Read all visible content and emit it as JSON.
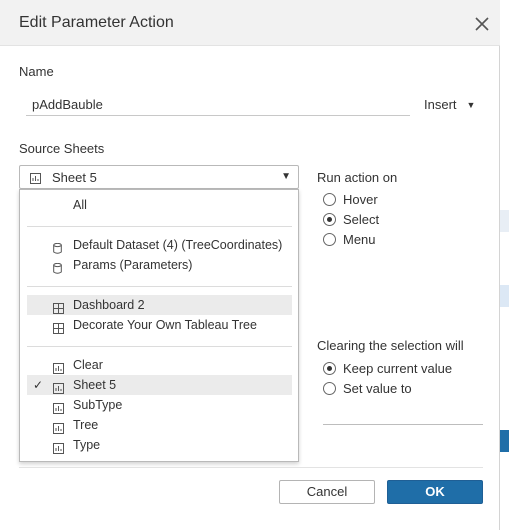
{
  "dialog": {
    "title": "Edit Parameter Action",
    "close_icon": "close-icon"
  },
  "name_section": {
    "label": "Name",
    "value": "pAddBauble",
    "insert_label": "Insert"
  },
  "source": {
    "label": "Source Sheets",
    "selected": "Sheet 5",
    "dropdown": {
      "all_label": "All",
      "datasources": [
        {
          "label": "Default Dataset (4) (TreeCoordinates)",
          "icon": "datasource-icon"
        },
        {
          "label": "Params (Parameters)",
          "icon": "datasource-icon"
        }
      ],
      "dashboards": [
        {
          "label": "Dashboard 2",
          "icon": "dashboard-icon"
        },
        {
          "label": "Decorate Your Own Tableau Tree",
          "icon": "dashboard-icon"
        }
      ],
      "sheets": [
        {
          "label": "Clear",
          "icon": "sheet-icon"
        },
        {
          "label": "Sheet 5",
          "icon": "sheet-icon",
          "checked": true
        },
        {
          "label": "SubType",
          "icon": "sheet-icon"
        },
        {
          "label": "Tree",
          "icon": "sheet-icon"
        },
        {
          "label": "Type",
          "icon": "sheet-icon"
        }
      ],
      "check_mark": "✓"
    }
  },
  "run_action": {
    "label": "Run action on",
    "options": [
      "Hover",
      "Select",
      "Menu"
    ],
    "selected": "Select"
  },
  "clearing": {
    "label": "Clearing the selection will",
    "options": [
      "Keep current value",
      "Set value to"
    ],
    "selected": "Keep current value"
  },
  "buttons": {
    "cancel": "Cancel",
    "ok": "OK"
  },
  "colors": {
    "ok_button": "#1f6ea8",
    "title_bar": "#f2f2f2",
    "highlight": "#ebebeb"
  }
}
